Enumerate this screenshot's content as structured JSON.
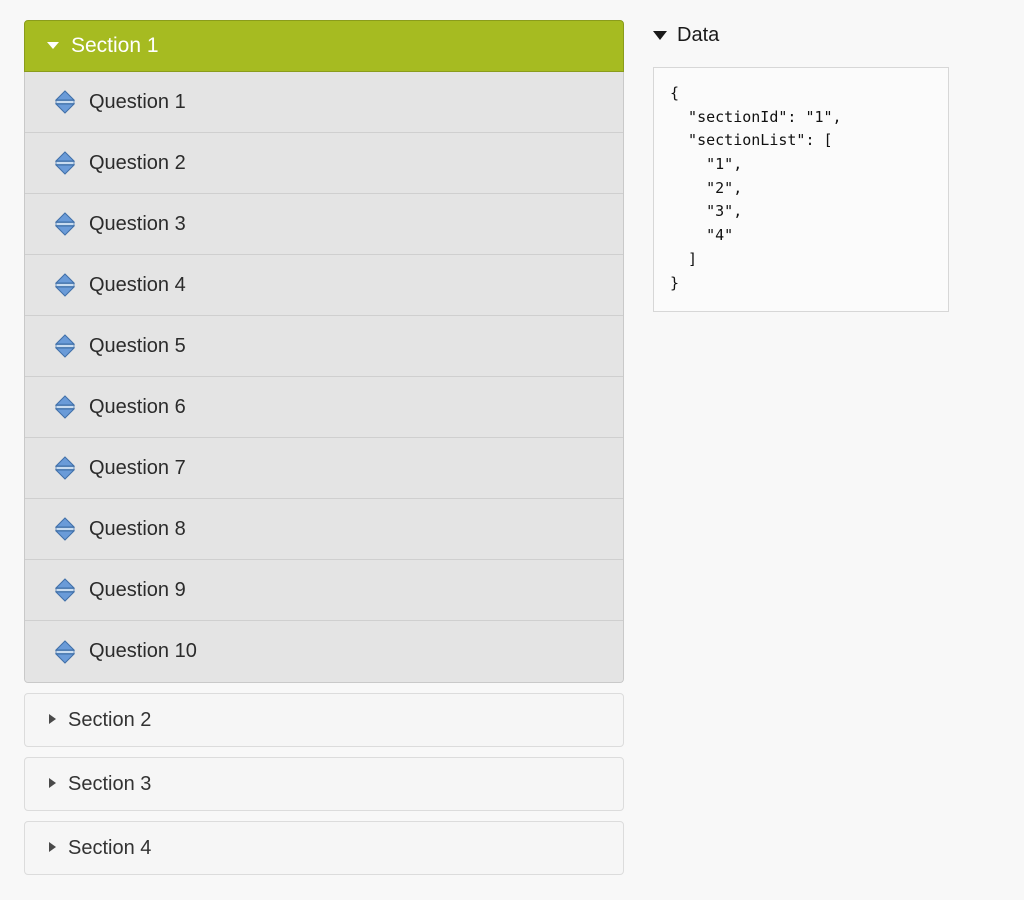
{
  "accordion": {
    "sections": [
      {
        "label": "Section 1",
        "state": "expanded",
        "toggle_icon": "caret-down-icon",
        "questions": [
          {
            "label": "Question 1",
            "handle_icon": "sort-updown-icon"
          },
          {
            "label": "Question 2",
            "handle_icon": "sort-updown-icon"
          },
          {
            "label": "Question 3",
            "handle_icon": "sort-updown-icon"
          },
          {
            "label": "Question 4",
            "handle_icon": "sort-updown-icon"
          },
          {
            "label": "Question 5",
            "handle_icon": "sort-updown-icon"
          },
          {
            "label": "Question 6",
            "handle_icon": "sort-updown-icon"
          },
          {
            "label": "Question 7",
            "handle_icon": "sort-updown-icon"
          },
          {
            "label": "Question 8",
            "handle_icon": "sort-updown-icon"
          },
          {
            "label": "Question 9",
            "handle_icon": "sort-updown-icon"
          },
          {
            "label": "Question 10",
            "handle_icon": "sort-updown-icon"
          }
        ]
      },
      {
        "label": "Section 2",
        "state": "collapsed",
        "toggle_icon": "caret-right-icon",
        "questions": []
      },
      {
        "label": "Section 3",
        "state": "collapsed",
        "toggle_icon": "caret-right-icon",
        "questions": []
      },
      {
        "label": "Section 4",
        "state": "collapsed",
        "toggle_icon": "caret-right-icon",
        "questions": []
      }
    ]
  },
  "data_panel": {
    "title": "Data",
    "toggle_icon": "caret-down-icon",
    "json_text": "{\n  \"sectionId\": \"1\",\n  \"sectionList\": [\n    \"1\",\n    \"2\",\n    \"3\",\n    \"4\"\n  ]\n}",
    "json_value": {
      "sectionId": "1",
      "sectionList": [
        "1",
        "2",
        "3",
        "4"
      ]
    }
  },
  "colors": {
    "page_background": "#f8f8f8",
    "active_section": "#a6bb21",
    "active_section_border": "#8a9c1c",
    "active_section_text": "#ffffff",
    "question_row": "#e4e4e4",
    "question_row_border": "#cfcfcf",
    "collapsed_section": "#f6f6f6",
    "collapsed_section_border": "#dcdcdc",
    "sort_handle_blue": "#5b92d0",
    "json_box_border": "#d7d7d7",
    "text_dark": "#2b2b2b"
  }
}
